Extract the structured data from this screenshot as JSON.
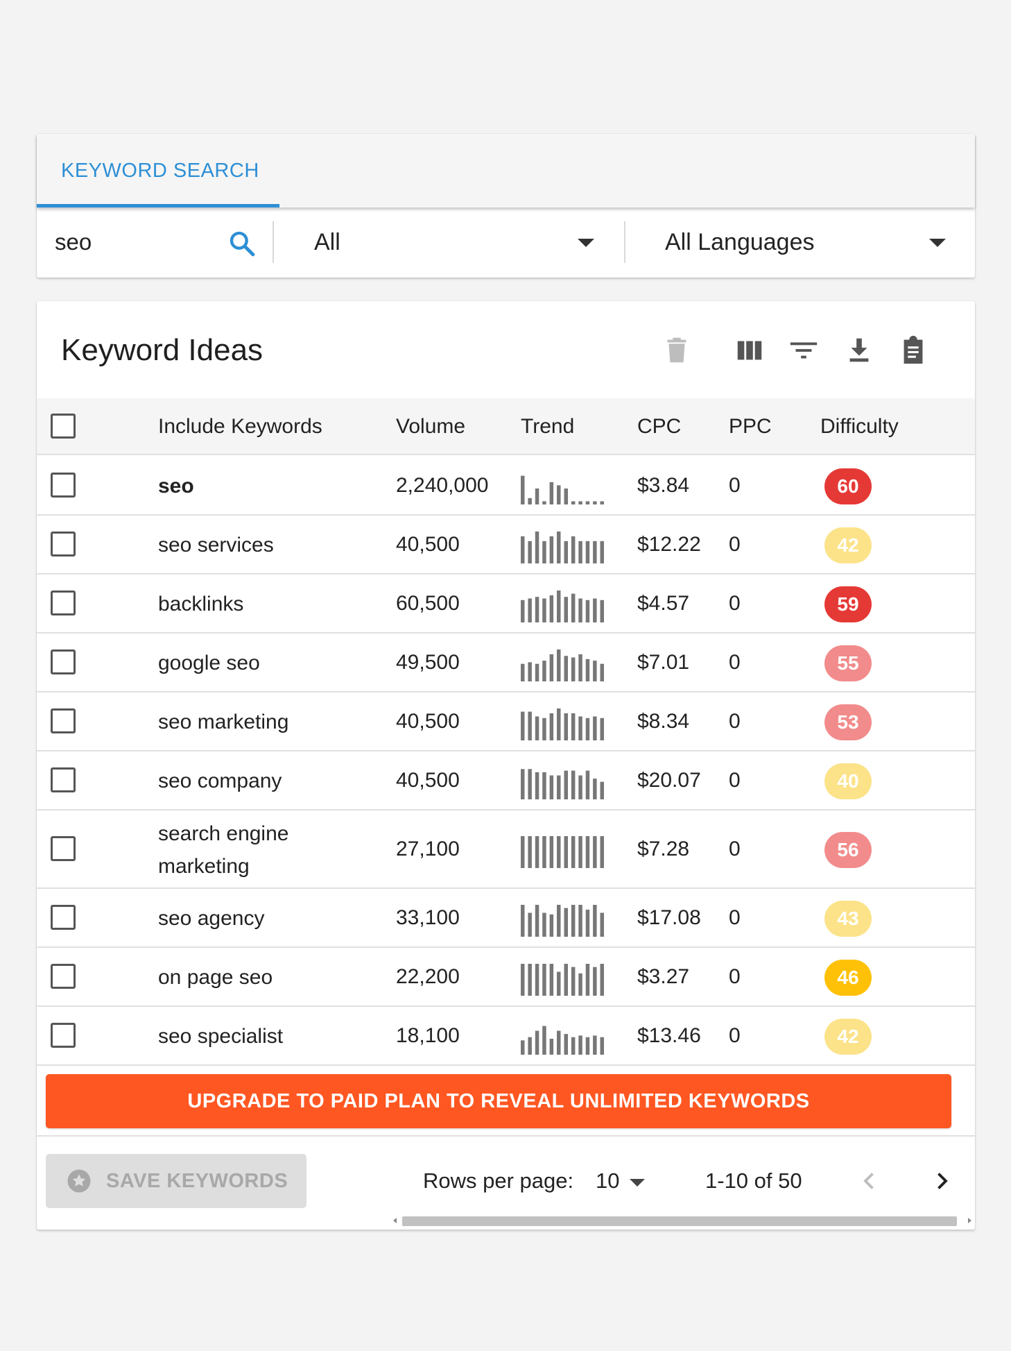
{
  "search": {
    "tab_label": "KEYWORD SEARCH",
    "query": "seo",
    "location": "All",
    "language": "All Languages"
  },
  "card": {
    "title": "Keyword Ideas",
    "toolbar_icons": [
      "delete-icon",
      "columns-icon",
      "filter-icon",
      "download-icon",
      "clipboard-icon"
    ]
  },
  "table": {
    "columns": [
      "Include Keywords",
      "Volume",
      "Trend",
      "CPC",
      "PPC",
      "Difficulty"
    ],
    "rows": [
      {
        "keyword": "seo",
        "volume": "2,240,000",
        "cpc": "$3.84",
        "ppc": "0",
        "difficulty": "60",
        "difficulty_color": "#e53935",
        "trend": [
          0.9,
          0.2,
          0.5,
          0.1,
          0.7,
          0.6,
          0.5,
          0.1,
          0.1,
          0.1,
          0.1,
          0.1
        ]
      },
      {
        "keyword": "seo services",
        "volume": "40,500",
        "cpc": "$12.22",
        "ppc": "0",
        "difficulty": "42",
        "difficulty_color": "#fce38a",
        "trend": [
          0.85,
          0.7,
          1.0,
          0.7,
          0.85,
          1.0,
          0.7,
          0.85,
          0.7,
          0.7,
          0.7,
          0.7
        ]
      },
      {
        "keyword": "backlinks",
        "volume": "60,500",
        "cpc": "$4.57",
        "ppc": "0",
        "difficulty": "59",
        "difficulty_color": "#e53935",
        "trend": [
          0.7,
          0.75,
          0.8,
          0.75,
          0.85,
          1.0,
          0.8,
          0.9,
          0.75,
          0.7,
          0.75,
          0.7
        ]
      },
      {
        "keyword": "google seo",
        "volume": "49,500",
        "cpc": "$7.01",
        "ppc": "0",
        "difficulty": "55",
        "difficulty_color": "#f28b8b",
        "trend": [
          0.55,
          0.6,
          0.55,
          0.65,
          0.85,
          1.0,
          0.8,
          0.75,
          0.85,
          0.7,
          0.65,
          0.55
        ]
      },
      {
        "keyword": "seo marketing",
        "volume": "40,500",
        "cpc": "$8.34",
        "ppc": "0",
        "difficulty": "53",
        "difficulty_color": "#f28b8b",
        "trend": [
          0.9,
          0.9,
          0.75,
          0.7,
          0.85,
          1.0,
          0.85,
          0.85,
          0.75,
          0.7,
          0.75,
          0.7
        ]
      },
      {
        "keyword": "seo company",
        "volume": "40,500",
        "cpc": "$20.07",
        "ppc": "0",
        "difficulty": "40",
        "difficulty_color": "#fce38a",
        "trend": [
          0.95,
          0.95,
          0.85,
          0.85,
          0.75,
          0.75,
          0.9,
          0.9,
          0.75,
          0.9,
          0.65,
          0.55
        ]
      },
      {
        "keyword": "search engine marketing",
        "volume": "27,100",
        "cpc": "$7.28",
        "ppc": "0",
        "difficulty": "56",
        "difficulty_color": "#f28b8b",
        "trend": [
          1.0,
          1.0,
          1.0,
          1.0,
          1.0,
          1.0,
          1.0,
          1.0,
          1.0,
          1.0,
          1.0,
          1.0
        ]
      },
      {
        "keyword": "seo agency",
        "volume": "33,100",
        "cpc": "$17.08",
        "ppc": "0",
        "difficulty": "43",
        "difficulty_color": "#fce38a",
        "trend": [
          1.0,
          0.75,
          1.0,
          0.75,
          0.7,
          1.0,
          0.9,
          1.0,
          1.0,
          0.85,
          1.0,
          0.75
        ]
      },
      {
        "keyword": "on page seo",
        "volume": "22,200",
        "cpc": "$3.27",
        "ppc": "0",
        "difficulty": "46",
        "difficulty_color": "#ffc107",
        "trend": [
          1.0,
          1.0,
          1.0,
          1.0,
          1.0,
          0.75,
          1.0,
          0.9,
          0.7,
          1.0,
          0.9,
          1.0
        ]
      },
      {
        "keyword": "seo specialist",
        "volume": "18,100",
        "cpc": "$13.46",
        "ppc": "0",
        "difficulty": "42",
        "difficulty_color": "#fce38a",
        "trend": [
          0.45,
          0.55,
          0.75,
          0.9,
          0.5,
          0.75,
          0.65,
          0.55,
          0.6,
          0.55,
          0.6,
          0.55
        ]
      }
    ]
  },
  "upgrade_label": "UPGRADE TO PAID PLAN TO REVEAL UNLIMITED KEYWORDS",
  "footer": {
    "save_label": "SAVE KEYWORDS",
    "rows_per_page_label": "Rows per page:",
    "rows_per_page_value": "10",
    "range_text": "1-10 of 50"
  },
  "colors": {
    "accent": "#2d8fd5",
    "upgrade": "#ff5722",
    "trend_bar": "#777777"
  }
}
